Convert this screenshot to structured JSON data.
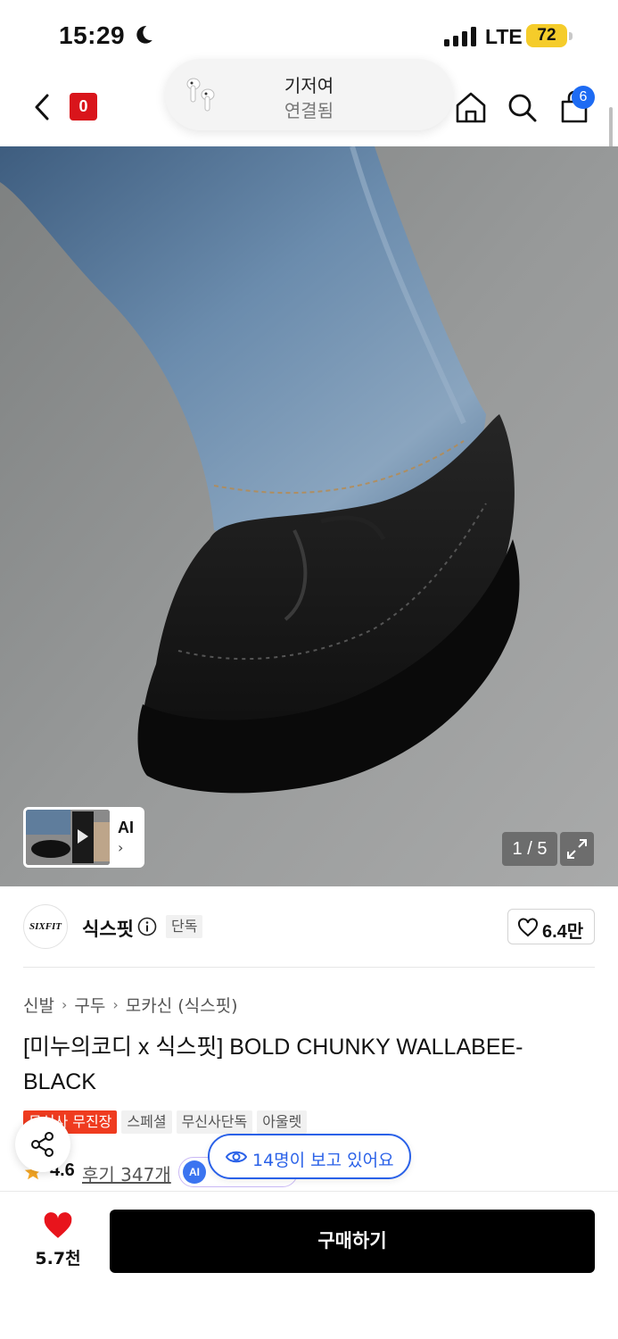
{
  "status_bar": {
    "time": "15:29",
    "network": "LTE",
    "battery": "72"
  },
  "nav": {
    "badge": "0",
    "cart_count": "6"
  },
  "airpods": {
    "title": "기저여",
    "subtitle": "연결됨"
  },
  "gallery": {
    "ai_label": "AI",
    "ai_chevron": "›",
    "counter": "1 / 5"
  },
  "brand": {
    "name": "식스핏",
    "logo_text": "SIXFIT",
    "exclusive": "단독",
    "likes": "6.4만"
  },
  "breadcrumb": [
    "신발",
    "구두",
    "모카신 (식스핏)"
  ],
  "breadcrumb_sep": "›",
  "product": {
    "title": "[미누의코디 x 식스핏] BOLD CHUNKY WALLABEE-BLACK"
  },
  "tags": [
    {
      "label": "무신사 무진장",
      "style": "red"
    },
    {
      "label": "스페셜",
      "style": "gray"
    },
    {
      "label": "무신사단독",
      "style": "gray"
    },
    {
      "label": "아울렛",
      "style": "gray"
    }
  ],
  "rating": {
    "value": "4.6",
    "reviews": "후기 347개",
    "ai_badge": "AI"
  },
  "viewers": "14명이 보고 있어요",
  "bottom": {
    "wish_count": "5.7천",
    "buy_label": "구매하기"
  },
  "colors": {
    "accent_blue": "#2a61e8",
    "sale_red": "#ef3b1f",
    "heart_red": "#e8141c"
  }
}
